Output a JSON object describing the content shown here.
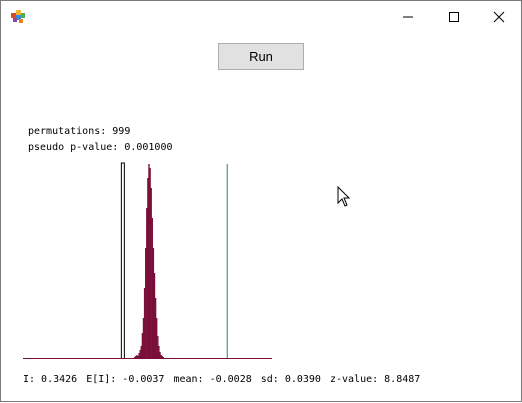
{
  "titlebar": {
    "minimize_icon": "minimize-icon",
    "maximize_icon": "maximize-icon",
    "close_icon": "close-icon"
  },
  "run_button": {
    "label": "Run"
  },
  "info": {
    "permutations": "permutations: 999",
    "pseudo_p": "pseudo p-value: 0.001000"
  },
  "chart_data": {
    "type": "histogram",
    "title": "",
    "xlabel": "",
    "ylabel": "",
    "bars_color": "#7a0f3a",
    "observed_line_color": "#2e8b57",
    "mean_marker_color": "#000000",
    "observed_I": 0.3426,
    "expected_I": -0.0037,
    "mean": -0.0028,
    "sd": 0.039,
    "bins": [
      1,
      2,
      3,
      2,
      5,
      8,
      12,
      25,
      40,
      70,
      110,
      150,
      180,
      194,
      190,
      170,
      140,
      110,
      85,
      60,
      40,
      22,
      12,
      6,
      3,
      2,
      1
    ]
  },
  "stats": {
    "I": "I: 0.3426",
    "EI": "E[I]: -0.0037",
    "mean": "mean: -0.0028",
    "sd": "sd: 0.0390",
    "z": "z-value: 8.8487"
  }
}
